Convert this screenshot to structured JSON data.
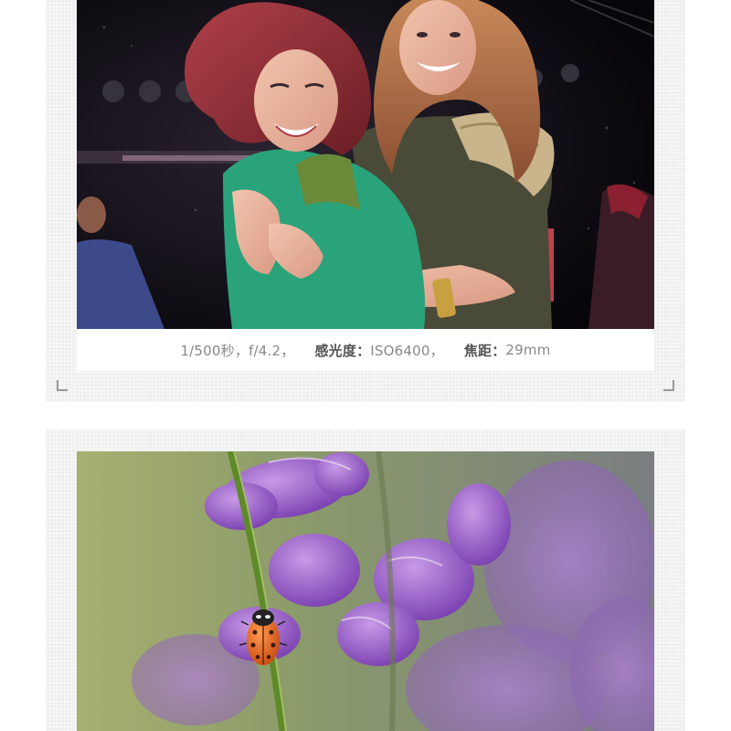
{
  "photo1": {
    "subject": "two-women-laughing-concert"
  },
  "caption": {
    "shutter": "1/500秒，f/4.2，",
    "iso_key": "感光度：",
    "iso_value": "ISO6400，",
    "focal_key": "焦距：",
    "focal_value": "29mm"
  },
  "photo2": {
    "subject": "ladybug-on-purple-lupine"
  },
  "colors": {
    "frame": "#eeeeee",
    "caption_text": "#777777",
    "corner_mark": "#999999"
  }
}
